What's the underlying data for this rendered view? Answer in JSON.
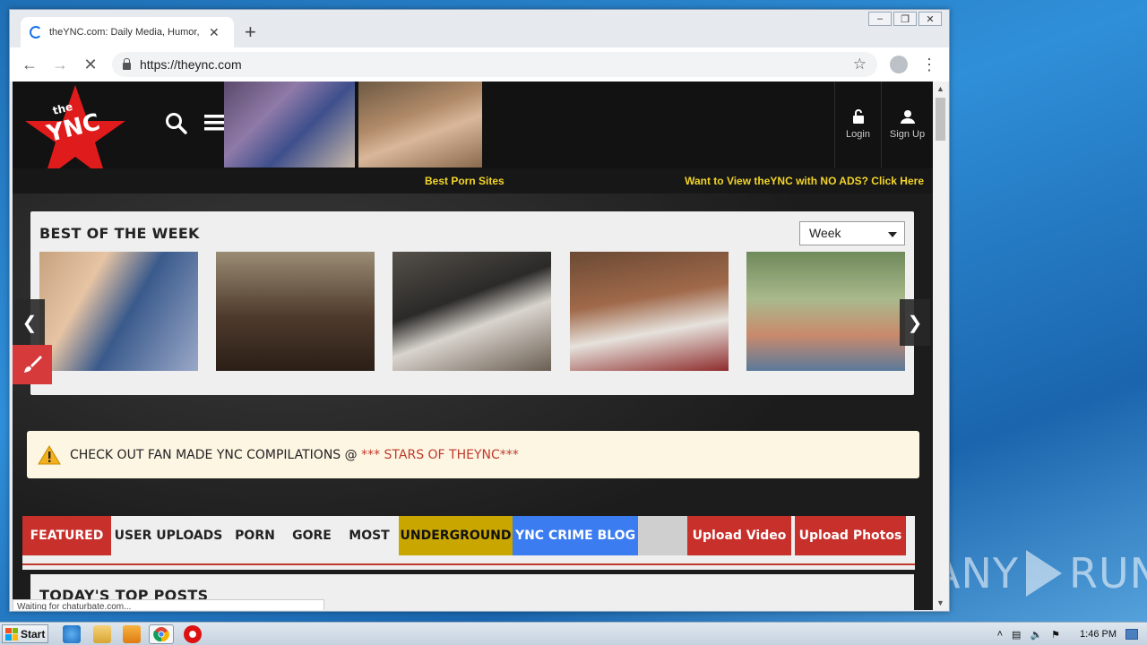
{
  "browser": {
    "tab_title": "theYNC.com: Daily Media, Humor, Sh",
    "url": "https://theync.com",
    "status_text": "Waiting for chaturbate.com..."
  },
  "site": {
    "header": {
      "logo_text": "theYNC.com",
      "login_label": "Login",
      "signup_label": "Sign Up"
    },
    "sub_bar": {
      "center_link": "Best Porn Sites",
      "right_link": "Want to View theYNC with NO ADS? Click Here"
    },
    "best_of_week": {
      "title": "BEST OF THE WEEK",
      "period_selected": "Week"
    },
    "notice": {
      "text": "CHECK OUT FAN MADE YNC COMPILATIONS @ ",
      "link": "*** STARS OF THEYNC***"
    },
    "nav": {
      "featured": "FEATURED",
      "user_uploads": "USER UPLOADS",
      "porn": "PORN",
      "gore": "GORE",
      "most": "MOST",
      "underground": "UNDERGROUND",
      "crime_blog": "YNC CRIME BLOG",
      "upload_video": "Upload Video",
      "upload_photos": "Upload Photos"
    },
    "top_posts_title": "TODAY'S TOP POSTS"
  },
  "desktop": {
    "watermark_left": "ANY",
    "watermark_right": "RUN"
  },
  "taskbar": {
    "start_label": "Start",
    "clock": "1:46 PM"
  }
}
